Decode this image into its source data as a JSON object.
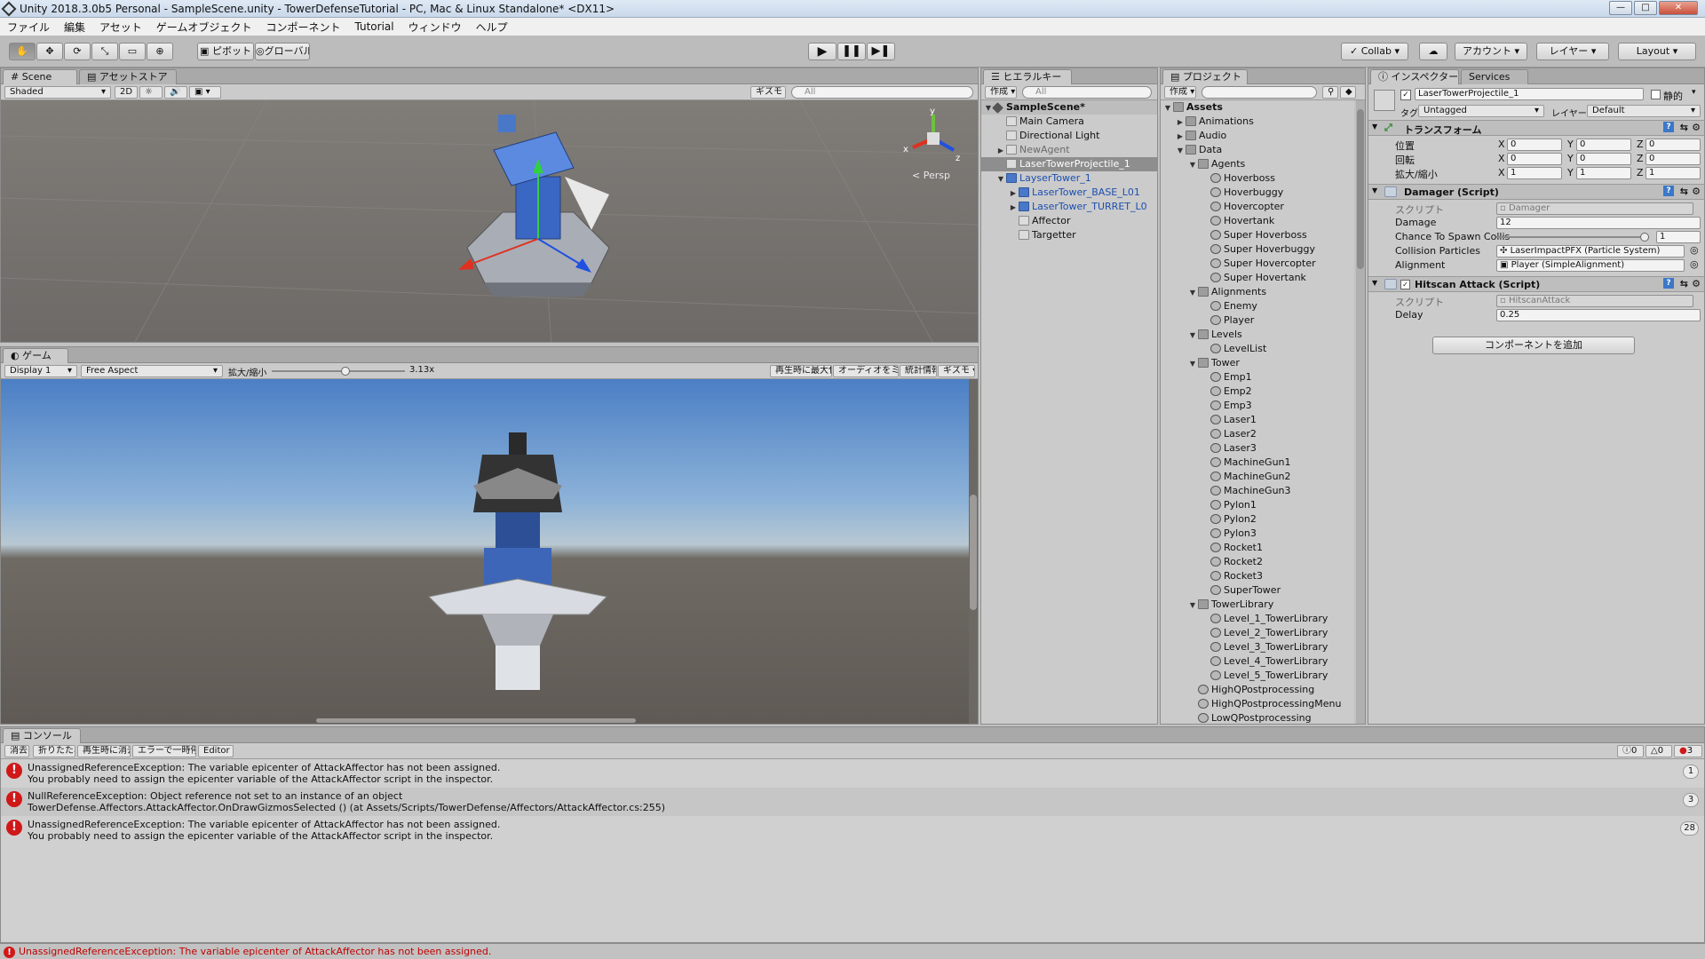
{
  "window": {
    "title": "Unity 2018.3.0b5 Personal - SampleScene.unity - TowerDefenseTutorial - PC, Mac & Linux Standalone* <DX11>"
  },
  "menu": [
    "ファイル",
    "編集",
    "アセット",
    "ゲームオブジェクト",
    "コンポーネント",
    "Tutorial",
    "ウィンドウ",
    "ヘルプ"
  ],
  "toolbar": {
    "pivot": "ピボット",
    "global": "グローバル",
    "collab": "Collab",
    "account": "アカウント",
    "layers": "レイヤー",
    "layout": "Layout"
  },
  "scene": {
    "tab_scene": "Scene",
    "tab_asset": "アセットストア",
    "shading": "Shaded",
    "mode2d": "2D",
    "gizmos": "ギズモ",
    "search": "All",
    "persp": "< Persp",
    "axis_x": "x",
    "axis_y": "y",
    "axis_z": "z"
  },
  "game": {
    "tab": "ゲーム",
    "display": "Display 1",
    "aspect": "Free Aspect",
    "scale_label": "拡大/縮小",
    "scale_value": "3.13x",
    "scale_fraction": 0.55,
    "maximize": "再生時に最大化",
    "mute": "オーディオをミュート",
    "stats": "統計情報",
    "gizmos": "ギズモ"
  },
  "hierarchy": {
    "tab": "ヒエラルキー",
    "create": "作成",
    "search": "All",
    "scene": "SampleScene*",
    "items": [
      {
        "label": "Main Camera",
        "depth": 1,
        "icon": "go",
        "arrow": "",
        "style": "",
        "selected": false
      },
      {
        "label": "Directional Light",
        "depth": 1,
        "icon": "go",
        "arrow": "",
        "style": "",
        "selected": false
      },
      {
        "label": "NewAgent",
        "depth": 1,
        "icon": "go",
        "arrow": "▶",
        "style": "light",
        "selected": false
      },
      {
        "label": "LaserTowerProjectile_1",
        "depth": 1,
        "icon": "go",
        "arrow": "",
        "style": "",
        "selected": true
      },
      {
        "label": "LayserTower_1",
        "depth": 1,
        "icon": "prefab",
        "arrow": "▼",
        "style": "prefab",
        "selected": false
      },
      {
        "label": "LaserTower_BASE_L01",
        "depth": 2,
        "icon": "prefab",
        "arrow": "▶",
        "style": "prefab",
        "selected": false
      },
      {
        "label": "LaserTower_TURRET_L0",
        "depth": 2,
        "icon": "prefab",
        "arrow": "▶",
        "style": "prefab",
        "selected": false
      },
      {
        "label": "Affector",
        "depth": 2,
        "icon": "go",
        "arrow": "",
        "style": "",
        "selected": false
      },
      {
        "label": "Targetter",
        "depth": 2,
        "icon": "go",
        "arrow": "",
        "style": "",
        "selected": false
      }
    ]
  },
  "project": {
    "tab": "プロジェクト",
    "create": "作成",
    "items": [
      {
        "label": "Assets",
        "depth": 0,
        "icon": "folder",
        "arrow": "▼",
        "bold": true
      },
      {
        "label": "Animations",
        "depth": 1,
        "icon": "folder",
        "arrow": "▶"
      },
      {
        "label": "Audio",
        "depth": 1,
        "icon": "folder",
        "arrow": "▶"
      },
      {
        "label": "Data",
        "depth": 1,
        "icon": "folder",
        "arrow": "▼"
      },
      {
        "label": "Agents",
        "depth": 2,
        "icon": "folder",
        "arrow": "▼"
      },
      {
        "label": "Hoverboss",
        "depth": 3,
        "icon": "asset",
        "arrow": ""
      },
      {
        "label": "Hoverbuggy",
        "depth": 3,
        "icon": "asset",
        "arrow": ""
      },
      {
        "label": "Hovercopter",
        "depth": 3,
        "icon": "asset",
        "arrow": ""
      },
      {
        "label": "Hovertank",
        "depth": 3,
        "icon": "asset",
        "arrow": ""
      },
      {
        "label": "Super Hoverboss",
        "depth": 3,
        "icon": "asset",
        "arrow": ""
      },
      {
        "label": "Super Hoverbuggy",
        "depth": 3,
        "icon": "asset",
        "arrow": ""
      },
      {
        "label": "Super Hovercopter",
        "depth": 3,
        "icon": "asset",
        "arrow": ""
      },
      {
        "label": "Super Hovertank",
        "depth": 3,
        "icon": "asset",
        "arrow": ""
      },
      {
        "label": "Alignments",
        "depth": 2,
        "icon": "folder",
        "arrow": "▼"
      },
      {
        "label": "Enemy",
        "depth": 3,
        "icon": "asset",
        "arrow": ""
      },
      {
        "label": "Player",
        "depth": 3,
        "icon": "asset",
        "arrow": ""
      },
      {
        "label": "Levels",
        "depth": 2,
        "icon": "folder",
        "arrow": "▼"
      },
      {
        "label": "LevelList",
        "depth": 3,
        "icon": "asset",
        "arrow": ""
      },
      {
        "label": "Tower",
        "depth": 2,
        "icon": "folder",
        "arrow": "▼"
      },
      {
        "label": "Emp1",
        "depth": 3,
        "icon": "asset",
        "arrow": ""
      },
      {
        "label": "Emp2",
        "depth": 3,
        "icon": "asset",
        "arrow": ""
      },
      {
        "label": "Emp3",
        "depth": 3,
        "icon": "asset",
        "arrow": ""
      },
      {
        "label": "Laser1",
        "depth": 3,
        "icon": "asset",
        "arrow": ""
      },
      {
        "label": "Laser2",
        "depth": 3,
        "icon": "asset",
        "arrow": ""
      },
      {
        "label": "Laser3",
        "depth": 3,
        "icon": "asset",
        "arrow": ""
      },
      {
        "label": "MachineGun1",
        "depth": 3,
        "icon": "asset",
        "arrow": ""
      },
      {
        "label": "MachineGun2",
        "depth": 3,
        "icon": "asset",
        "arrow": ""
      },
      {
        "label": "MachineGun3",
        "depth": 3,
        "icon": "asset",
        "arrow": ""
      },
      {
        "label": "Pylon1",
        "depth": 3,
        "icon": "asset",
        "arrow": ""
      },
      {
        "label": "Pylon2",
        "depth": 3,
        "icon": "asset",
        "arrow": ""
      },
      {
        "label": "Pylon3",
        "depth": 3,
        "icon": "asset",
        "arrow": ""
      },
      {
        "label": "Rocket1",
        "depth": 3,
        "icon": "asset",
        "arrow": ""
      },
      {
        "label": "Rocket2",
        "depth": 3,
        "icon": "asset",
        "arrow": ""
      },
      {
        "label": "Rocket3",
        "depth": 3,
        "icon": "asset",
        "arrow": ""
      },
      {
        "label": "SuperTower",
        "depth": 3,
        "icon": "asset",
        "arrow": ""
      },
      {
        "label": "TowerLibrary",
        "depth": 2,
        "icon": "folder",
        "arrow": "▼"
      },
      {
        "label": "Level_1_TowerLibrary",
        "depth": 3,
        "icon": "asset",
        "arrow": ""
      },
      {
        "label": "Level_2_TowerLibrary",
        "depth": 3,
        "icon": "asset",
        "arrow": ""
      },
      {
        "label": "Level_3_TowerLibrary",
        "depth": 3,
        "icon": "asset",
        "arrow": ""
      },
      {
        "label": "Level_4_TowerLibrary",
        "depth": 3,
        "icon": "asset",
        "arrow": ""
      },
      {
        "label": "Level_5_TowerLibrary",
        "depth": 3,
        "icon": "asset",
        "arrow": ""
      },
      {
        "label": "HighQPostprocessing",
        "depth": 2,
        "icon": "asset",
        "arrow": ""
      },
      {
        "label": "HighQPostprocessingMenu",
        "depth": 2,
        "icon": "asset",
        "arrow": ""
      },
      {
        "label": "LowQPostprocessing",
        "depth": 2,
        "icon": "asset",
        "arrow": ""
      }
    ]
  },
  "inspector": {
    "tab": "インスペクター",
    "tab2": "Services",
    "object_name": "LaserTowerProjectile_1",
    "static_label": "静的",
    "tag_label": "タグ",
    "tag_value": "Untagged",
    "layer_label": "レイヤー",
    "layer_value": "Default",
    "transform": {
      "title": "トランスフォーム",
      "position_label": "位置",
      "rotation_label": "回転",
      "scale_label": "拡大/縮小",
      "x": "X",
      "y": "Y",
      "z": "Z",
      "position": [
        "0",
        "0",
        "0"
      ],
      "rotation": [
        "0",
        "0",
        "0"
      ],
      "scale": [
        "1",
        "1",
        "1"
      ]
    },
    "damager": {
      "title": "Damager (Script)",
      "script_label": "スクリプト",
      "script_value": "Damager",
      "damage_label": "Damage",
      "damage_value": "12",
      "chance_label": "Chance To Spawn Collis",
      "chance_value": "1",
      "chance_fraction": 1.0,
      "particles_label": "Collision Particles",
      "particles_value": "LaserImpactPFX (Particle System)",
      "alignment_label": "Alignment",
      "alignment_value": "Player (SimpleAlignment)"
    },
    "hitscan": {
      "title": "Hitscan Attack (Script)",
      "script_label": "スクリプト",
      "script_value": "HitscanAttack",
      "delay_label": "Delay",
      "delay_value": "0.25"
    },
    "add_component": "コンポーネントを追加"
  },
  "console": {
    "tab": "コンソール",
    "clear": "消去",
    "collapse": "折りたたみ",
    "clear_on_play": "再生時に消去",
    "error_pause": "エラーで一時停止",
    "editor": "Editor",
    "info_count": "0",
    "warn_count": "0",
    "error_count": "3",
    "messages": [
      {
        "line1": "UnassignedReferenceException: The variable epicenter of AttackAffector has not been assigned.",
        "line2": "You probably need to assign the epicenter variable of the AttackAffector script in the inspector.",
        "count": "1"
      },
      {
        "line1": "NullReferenceException: Object reference not set to an instance of an object",
        "line2": "TowerDefense.Affectors.AttackAffector.OnDrawGizmosSelected () (at Assets/Scripts/TowerDefense/Affectors/AttackAffector.cs:255)",
        "count": "3"
      },
      {
        "line1": "UnassignedReferenceException: The variable epicenter of AttackAffector has not been assigned.",
        "line2": "You probably need to assign the epicenter variable of the AttackAffector script in the inspector.",
        "count": "28"
      }
    ]
  },
  "status": {
    "text": "UnassignedReferenceException: The variable epicenter of AttackAffector has not been assigned."
  },
  "colors": {
    "accent": "#4a78c8",
    "error": "#d01818",
    "prefab_text": "#1c4fb0"
  }
}
